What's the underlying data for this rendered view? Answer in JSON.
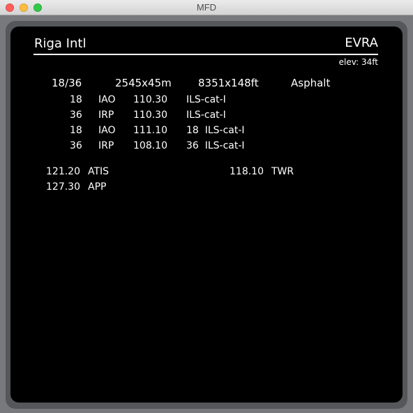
{
  "window": {
    "title": "MFD"
  },
  "header": {
    "name": "Riga Intl",
    "code": "EVRA",
    "elevation": "elev: 34ft"
  },
  "runway": {
    "ident": "18/36",
    "size_m": "2545x45m",
    "size_ft": "8351x148ft",
    "surface": "Asphalt"
  },
  "approaches": [
    {
      "rwy": "18",
      "id": "IAO",
      "freq": "110.30",
      "type": "ILS-cat-I"
    },
    {
      "rwy": "36",
      "id": "IRP",
      "freq": "110.30",
      "type": "ILS-cat-I"
    },
    {
      "rwy": "18",
      "id": "IAO",
      "freq": "111.10",
      "type": "18  ILS-cat-I"
    },
    {
      "rwy": "36",
      "id": "IRP",
      "freq": "108.10",
      "type": "36  ILS-cat-I"
    }
  ],
  "comms": {
    "left": [
      {
        "freq": "121.20",
        "name": "ATIS"
      },
      {
        "freq": "127.30",
        "name": "APP"
      }
    ],
    "right": [
      {
        "freq": "118.10",
        "name": "TWR"
      }
    ]
  }
}
